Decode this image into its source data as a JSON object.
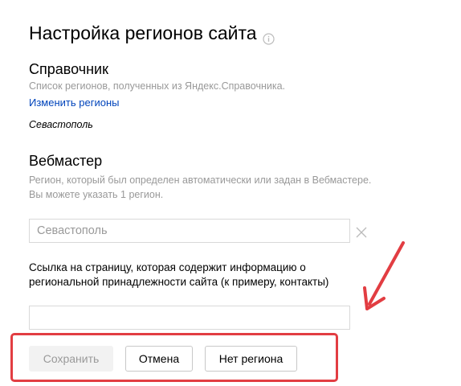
{
  "page": {
    "title": "Настройка регионов сайта",
    "info_icon": "info-circle-icon"
  },
  "directory": {
    "heading": "Справочник",
    "description": "Список регионов, полученных из Яндекс.Справочника.",
    "change_link": "Изменить регионы",
    "region_value": "Севастополь"
  },
  "webmaster": {
    "heading": "Вебмастер",
    "description_line1": "Регион, который был определен автоматически или задан в Вебмастере.",
    "description_line2": "Вы можете указать 1 регион.",
    "region_input_placeholder": "Севастополь",
    "clear_icon": "close-icon"
  },
  "link_field": {
    "label": "Ссылка на страницу, которая содержит информацию о региональной принадлежности сайта (к примеру, контакты)",
    "value": ""
  },
  "buttons": {
    "save": "Сохранить",
    "cancel": "Отмена",
    "no_region": "Нет региона"
  },
  "annotation": {
    "color": "#e23d42"
  }
}
